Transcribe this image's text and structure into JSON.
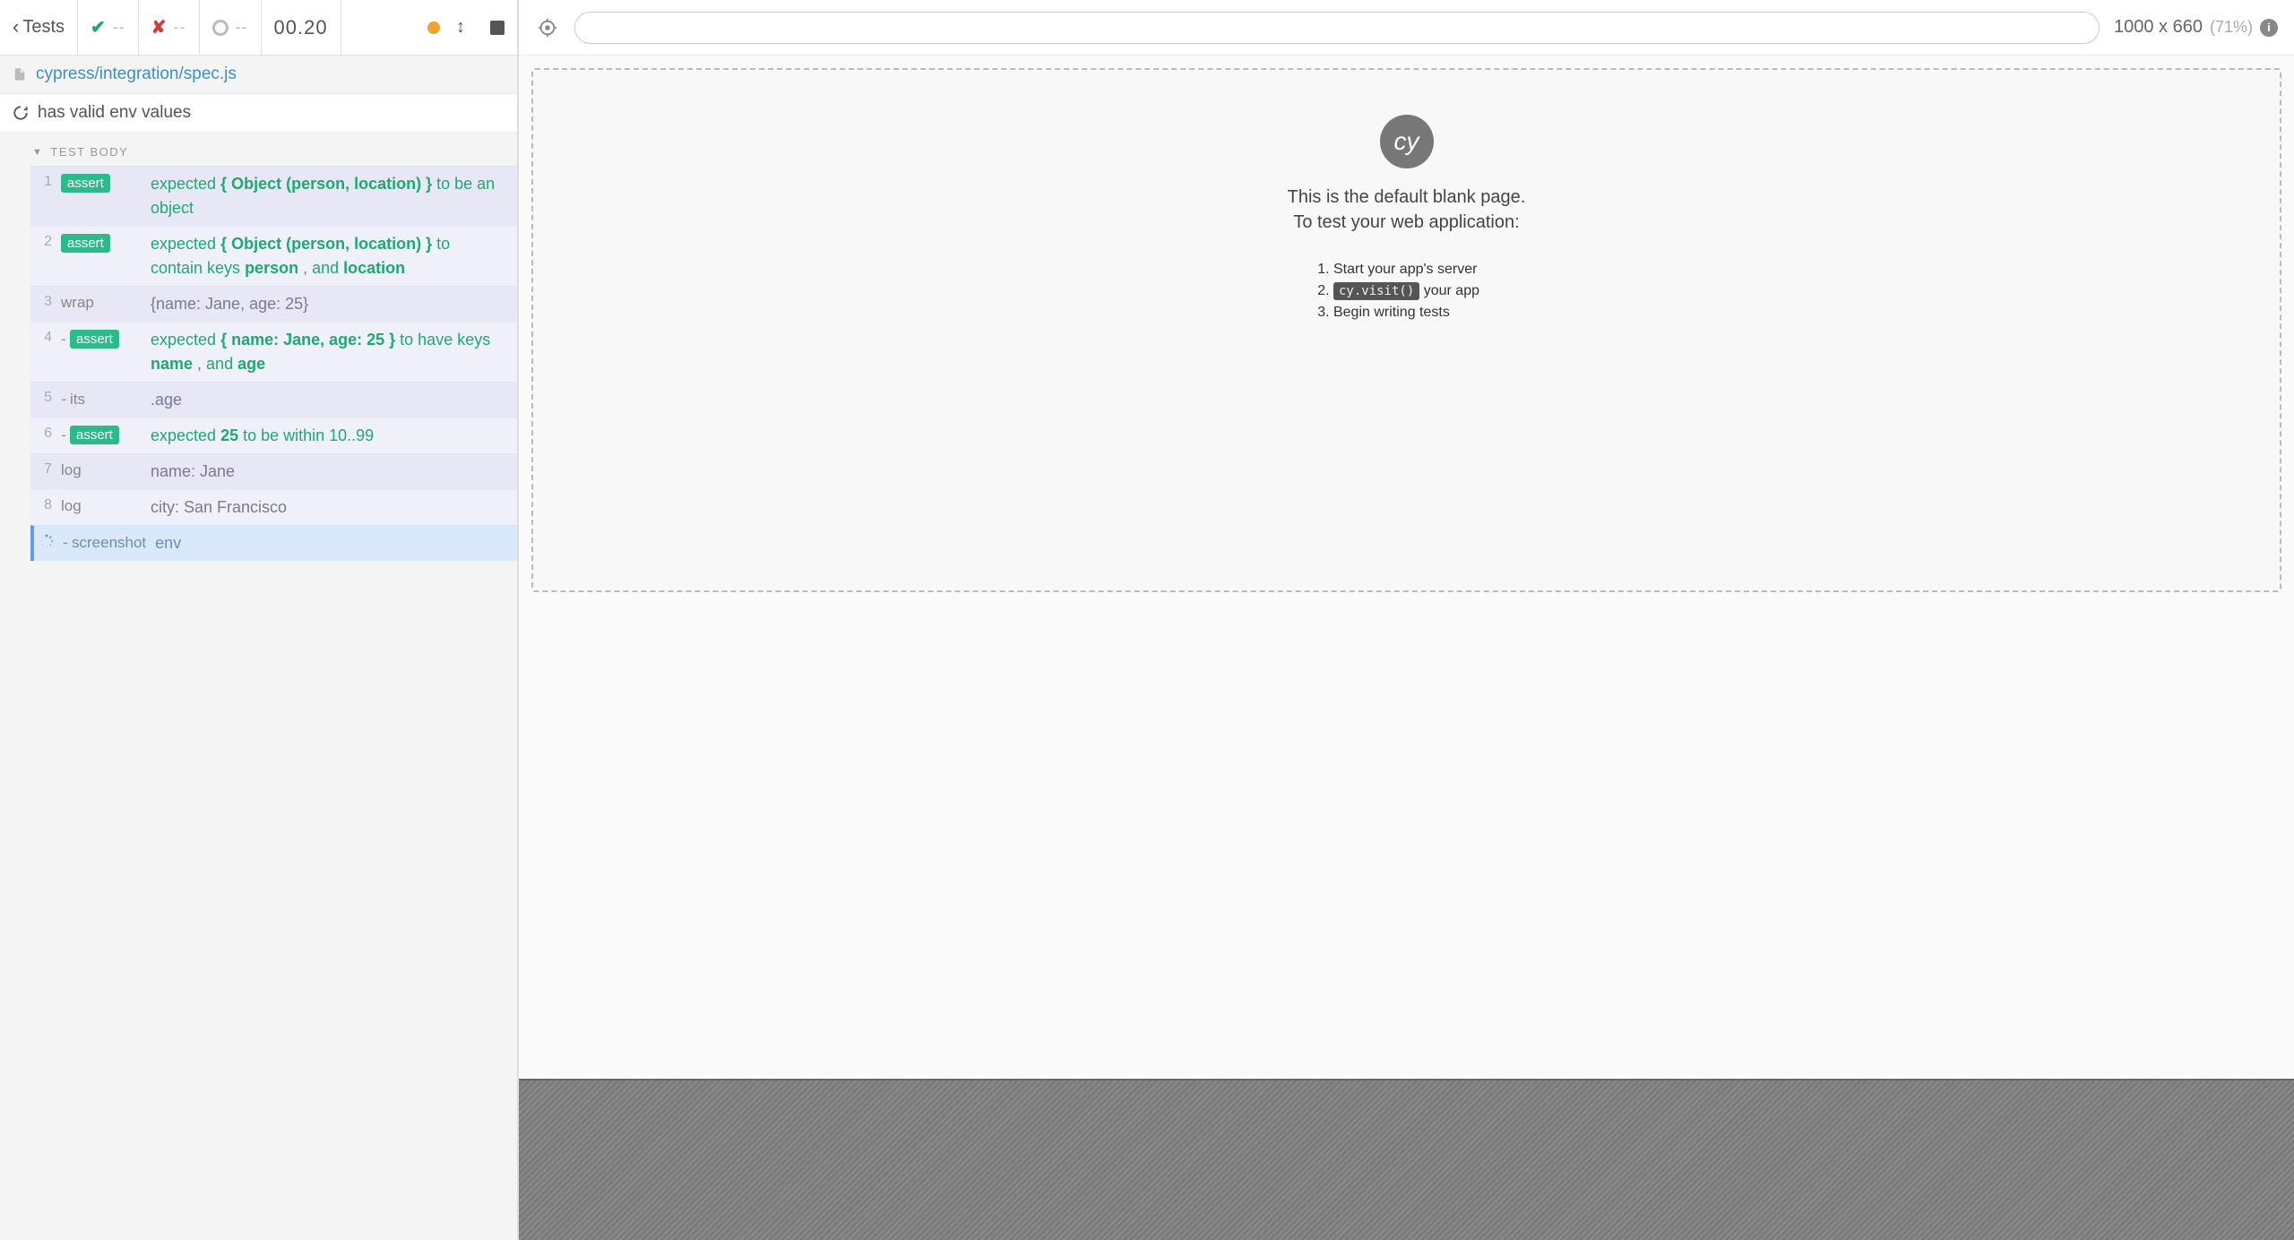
{
  "header": {
    "back_label": "Tests",
    "passed": "--",
    "failed": "--",
    "pending": "--",
    "timer": "00.20"
  },
  "spec": {
    "path": "cypress/integration/spec.js"
  },
  "test": {
    "title": "has valid env values",
    "section": "TEST BODY"
  },
  "commands": [
    {
      "num": "1",
      "method": "assert",
      "badge": true,
      "child": false,
      "segments": [
        {
          "t": "expected ",
          "c": "kw"
        },
        {
          "t": "{ Object (person, location) }",
          "c": "strong"
        },
        {
          "t": " to be an object",
          "c": "kw"
        }
      ]
    },
    {
      "num": "2",
      "method": "assert",
      "badge": true,
      "child": false,
      "segments": [
        {
          "t": "expected ",
          "c": "kw"
        },
        {
          "t": "{ Object (person, location) }",
          "c": "strong"
        },
        {
          "t": " to contain keys ",
          "c": "kw"
        },
        {
          "t": "person",
          "c": "strong"
        },
        {
          "t": " ,",
          "c": "plain"
        },
        {
          "t": " and ",
          "c": "kw"
        },
        {
          "t": "location",
          "c": "strong"
        }
      ]
    },
    {
      "num": "3",
      "method": "wrap",
      "badge": false,
      "child": false,
      "segments": [
        {
          "t": "{name: Jane, age: 25}",
          "c": "plain"
        }
      ]
    },
    {
      "num": "4",
      "method": "assert",
      "badge": true,
      "child": true,
      "segments": [
        {
          "t": "expected ",
          "c": "kw"
        },
        {
          "t": "{ name: Jane, age: 25 }",
          "c": "strong"
        },
        {
          "t": " to have keys ",
          "c": "kw"
        },
        {
          "t": "name",
          "c": "strong"
        },
        {
          "t": " ,",
          "c": "plain"
        },
        {
          "t": " and ",
          "c": "kw"
        },
        {
          "t": "age",
          "c": "strong"
        }
      ]
    },
    {
      "num": "5",
      "method": "its",
      "badge": false,
      "child": true,
      "segments": [
        {
          "t": ".age",
          "c": "plain"
        }
      ]
    },
    {
      "num": "6",
      "method": "assert",
      "badge": true,
      "child": true,
      "segments": [
        {
          "t": "expected ",
          "c": "kw"
        },
        {
          "t": "25",
          "c": "strong"
        },
        {
          "t": " to be within 10..99",
          "c": "kw"
        }
      ]
    },
    {
      "num": "7",
      "method": "log",
      "badge": false,
      "child": false,
      "segments": [
        {
          "t": "name: Jane",
          "c": "plain"
        }
      ]
    },
    {
      "num": "8",
      "method": "log",
      "badge": false,
      "child": false,
      "segments": [
        {
          "t": "city: San Francisco",
          "c": "plain"
        }
      ]
    }
  ],
  "running_command": {
    "method": "screenshot",
    "arg": "env"
  },
  "aut": {
    "viewport": "1000 x 660",
    "scale": "(71%)",
    "blank_line1": "This is the default blank page.",
    "blank_line2": "To test your web application:",
    "step1": "Start your app's server",
    "step2_code": "cy.visit()",
    "step2_rest": " your app",
    "step3": "Begin writing tests",
    "logo": "cy"
  }
}
